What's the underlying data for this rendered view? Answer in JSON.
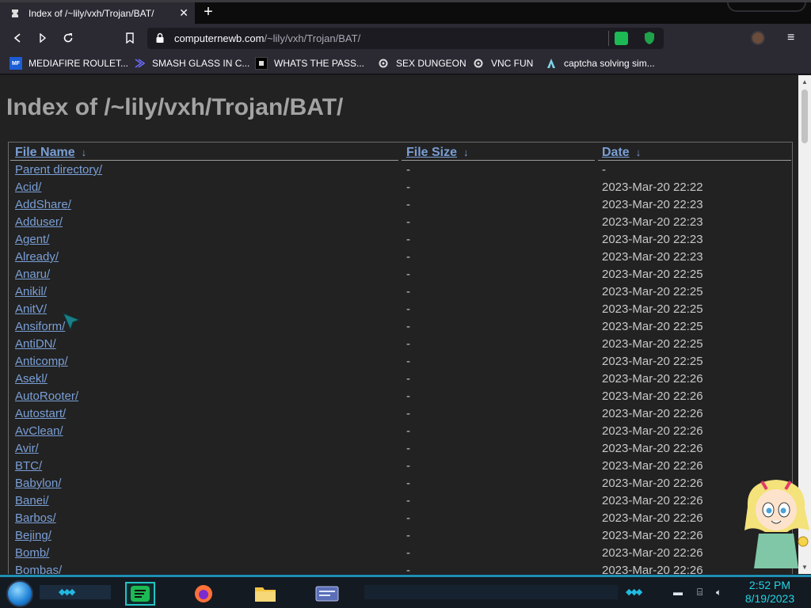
{
  "browser": {
    "tab_title": "Index of /~lily/vxh/Trojan/BAT/",
    "tab_close": "✕",
    "new_tab": "+",
    "url_domain": "computernewb.com",
    "url_path": "/~lily/vxh/Trojan/BAT/",
    "menu_icon": "≡"
  },
  "bookmarks": [
    {
      "label": "MEDIAFIRE ROULET...",
      "icon": "MF"
    },
    {
      "label": "SMASH GLASS IN C...",
      "icon": "chevron-icon"
    },
    {
      "label": "WHATS THE PASS...",
      "icon": "window-icon"
    },
    {
      "label": "SEX DUNGEON",
      "icon": "gear-icon"
    },
    {
      "label": "VNC FUN",
      "icon": "gear-icon"
    },
    {
      "label": "captcha solving sim...",
      "icon": "delta-icon"
    }
  ],
  "page": {
    "heading": "Index of /~lily/vxh/Trojan/BAT/",
    "columns": {
      "name": "File Name",
      "size": "File Size",
      "date": "Date",
      "sort_arrow": "↓"
    },
    "rows": [
      {
        "name": "Parent directory/",
        "size": "-",
        "date": "-"
      },
      {
        "name": "Acid/",
        "size": "-",
        "date": "2023-Mar-20 22:22"
      },
      {
        "name": "AddShare/",
        "size": "-",
        "date": "2023-Mar-20 22:23"
      },
      {
        "name": "Adduser/",
        "size": "-",
        "date": "2023-Mar-20 22:23"
      },
      {
        "name": "Agent/",
        "size": "-",
        "date": "2023-Mar-20 22:23"
      },
      {
        "name": "Already/",
        "size": "-",
        "date": "2023-Mar-20 22:23"
      },
      {
        "name": "Anaru/",
        "size": "-",
        "date": "2023-Mar-20 22:25"
      },
      {
        "name": "Anikil/",
        "size": "-",
        "date": "2023-Mar-20 22:25"
      },
      {
        "name": "AnitV/",
        "size": "-",
        "date": "2023-Mar-20 22:25"
      },
      {
        "name": "Ansiform/",
        "size": "-",
        "date": "2023-Mar-20 22:25"
      },
      {
        "name": "AntiDN/",
        "size": "-",
        "date": "2023-Mar-20 22:25"
      },
      {
        "name": "Anticomp/",
        "size": "-",
        "date": "2023-Mar-20 22:25"
      },
      {
        "name": "Asekl/",
        "size": "-",
        "date": "2023-Mar-20 22:26"
      },
      {
        "name": "AutoRooter/",
        "size": "-",
        "date": "2023-Mar-20 22:26"
      },
      {
        "name": "Autostart/",
        "size": "-",
        "date": "2023-Mar-20 22:26"
      },
      {
        "name": "AvClean/",
        "size": "-",
        "date": "2023-Mar-20 22:26"
      },
      {
        "name": "Avir/",
        "size": "-",
        "date": "2023-Mar-20 22:26"
      },
      {
        "name": "BTC/",
        "size": "-",
        "date": "2023-Mar-20 22:26"
      },
      {
        "name": "Babylon/",
        "size": "-",
        "date": "2023-Mar-20 22:26"
      },
      {
        "name": "Banei/",
        "size": "-",
        "date": "2023-Mar-20 22:26"
      },
      {
        "name": "Barbos/",
        "size": "-",
        "date": "2023-Mar-20 22:26"
      },
      {
        "name": "Bejing/",
        "size": "-",
        "date": "2023-Mar-20 22:26"
      },
      {
        "name": "Bomb/",
        "size": "-",
        "date": "2023-Mar-20 22:26"
      },
      {
        "name": "Bombas/",
        "size": "-",
        "date": "2023-Mar-20 22:26"
      }
    ]
  },
  "taskbar": {
    "time": "2:52 PM",
    "date": "8/19/2023",
    "apps": [
      "spotify-icon",
      "firefox-icon",
      "file-explorer-icon",
      "window-app-icon"
    ]
  },
  "colors": {
    "link": "#7a9fd6",
    "page_bg": "#222222",
    "accent": "#1fd6e6"
  }
}
